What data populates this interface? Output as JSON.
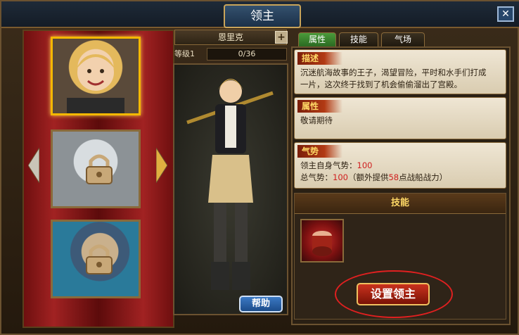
{
  "window": {
    "title": "领主",
    "close_icon": "close-icon"
  },
  "portraits": [
    {
      "name": "portrait-1",
      "locked": false,
      "selected": true
    },
    {
      "name": "portrait-2",
      "locked": true,
      "selected": false
    },
    {
      "name": "portrait-3",
      "locked": true,
      "selected": false
    }
  ],
  "character": {
    "name": "恩里克",
    "level_label": "等级1",
    "exp": "0/36"
  },
  "tabs": [
    {
      "label": "属性",
      "active": true
    },
    {
      "label": "技能",
      "active": false
    },
    {
      "label": "气场",
      "active": false
    }
  ],
  "description": {
    "heading": "描述",
    "line1": "沉迷航海故事的王子，渴望冒险，平时和水手们打成",
    "line2": "一片，这次终于找到了机会偷偷溜出了宫殿。"
  },
  "attributes": {
    "heading": "属性",
    "text": "敬请期待"
  },
  "momentum": {
    "heading": "气势",
    "self_label": "领主自身气势：",
    "self_value": "100",
    "total_label": "总气势：",
    "total_value": "100",
    "extra_prefix": "（额外提供",
    "extra_value": "58",
    "extra_suffix": "点战船战力）"
  },
  "skills": {
    "heading": "技能",
    "icon": "drum-skill-icon"
  },
  "buttons": {
    "help": "帮助",
    "set_lord": "设置领主"
  },
  "colors": {
    "highlight": "#d02020",
    "selected_border": "#f4b800"
  }
}
